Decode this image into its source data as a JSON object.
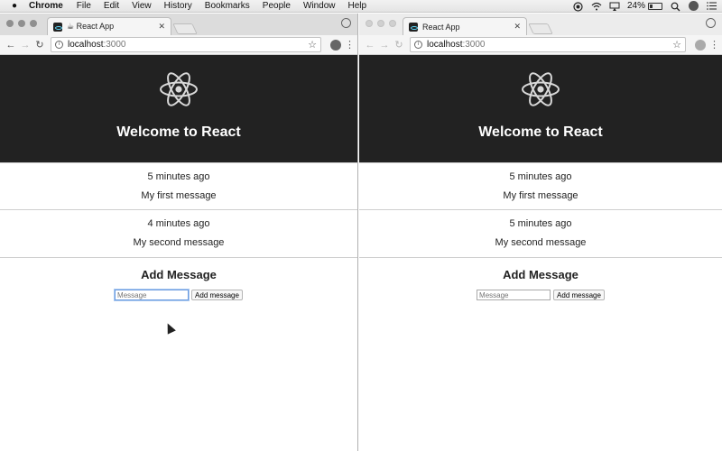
{
  "menubar": {
    "app_name": "Chrome",
    "items": [
      "File",
      "Edit",
      "View",
      "History",
      "Bookmarks",
      "People",
      "Window",
      "Help"
    ],
    "battery_percent": "24%",
    "battery_level": 0.24
  },
  "windows": [
    {
      "tab_title": "☕ React App",
      "url_host": "localhost",
      "url_port": ":3000",
      "hero_title": "Welcome to React",
      "messages": [
        {
          "time": "5 minutes ago",
          "text": "My first message"
        },
        {
          "time": "4 minutes ago",
          "text": "My second message"
        }
      ],
      "add_heading": "Add Message",
      "input_placeholder": "Message",
      "button_label": "Add message"
    },
    {
      "tab_title": "React App",
      "url_host": "localhost",
      "url_port": ":3000",
      "hero_title": "Welcome to React",
      "messages": [
        {
          "time": "5 minutes ago",
          "text": "My first message"
        },
        {
          "time": "5 minutes ago",
          "text": "My second message"
        }
      ],
      "add_heading": "Add Message",
      "input_placeholder": "Message",
      "button_label": "Add message"
    }
  ],
  "colors": {
    "header_bg": "#222222",
    "react_logo": "#d8d8d8"
  }
}
